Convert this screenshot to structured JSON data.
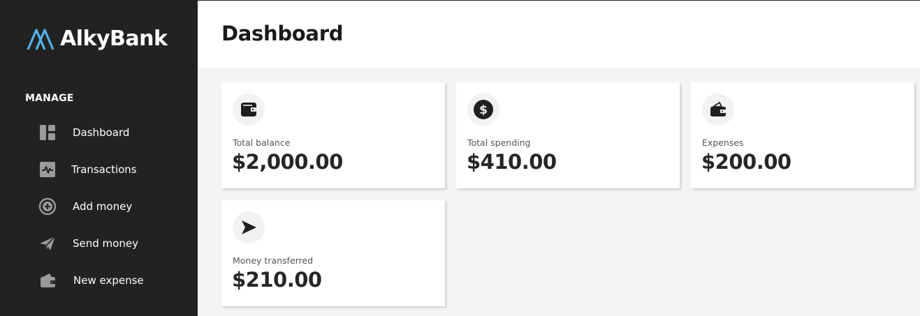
{
  "app": {
    "brand_name": "AlkyBank",
    "brand_color": "#4fb3e8"
  },
  "sidebar": {
    "section_title": "MANAGE",
    "items": [
      {
        "label": "Dashboard",
        "icon": "dashboard-icon"
      },
      {
        "label": "Transactions",
        "icon": "activity-icon"
      },
      {
        "label": "Add money",
        "icon": "plus-circle-icon"
      },
      {
        "label": "Send money",
        "icon": "paper-plane-icon"
      },
      {
        "label": "New expense",
        "icon": "wallet-icon"
      }
    ]
  },
  "header": {
    "title": "Dashboard"
  },
  "cards": [
    {
      "label": "Total balance",
      "value": "$2,000.00",
      "icon": "wallet-icon"
    },
    {
      "label": "Total spending",
      "value": "$410.00",
      "icon": "dollar-circle-icon"
    },
    {
      "label": "Expenses",
      "value": "$200.00",
      "icon": "wallet-open-icon"
    },
    {
      "label": "Money transferred",
      "value": "$210.00",
      "icon": "send-arrow-icon"
    }
  ]
}
